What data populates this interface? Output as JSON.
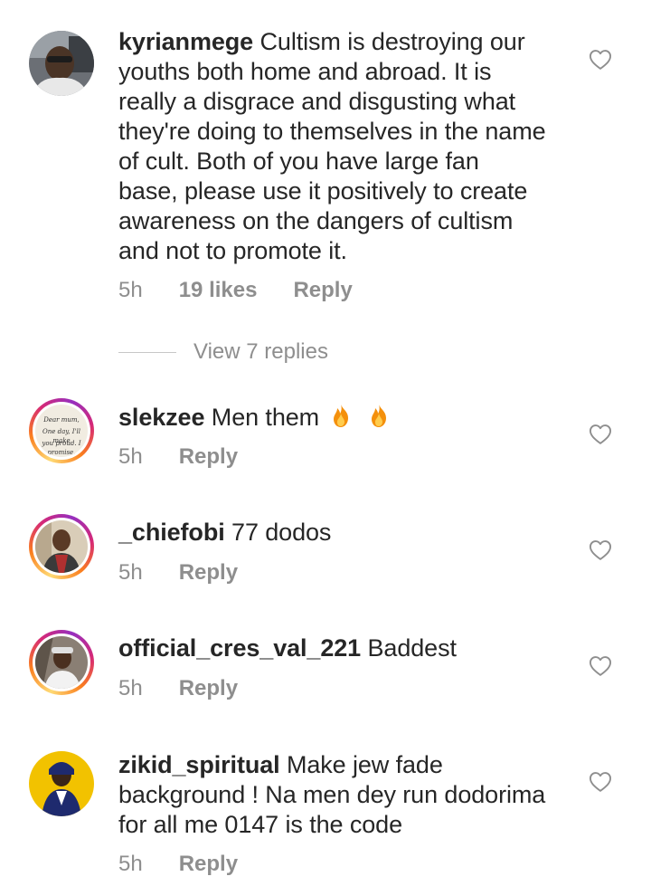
{
  "comments": [
    {
      "username": "kyrianmege",
      "text": "Cultism is destroying our youths both home and abroad. It is really a disgrace and disgusting what they're doing to themselves in the name of cult. Both of you have large fan base, please use it positively to create awareness on the dangers of cultism and not to promote it.",
      "lines": [
        "Cultism is destroying our",
        "youths both home and abroad. It is",
        "really a disgrace and disgusting what",
        "they're doing to themselves in the name",
        "of cult. Both of you have large fan",
        "base, please use it positively to create",
        "awareness on the dangers of cultism",
        "and not to promote it."
      ],
      "time": "5h",
      "likes": "19 likes",
      "reply": "Reply"
    },
    {
      "username": "slekzee",
      "text": "Men them",
      "time": "5h",
      "reply": "Reply",
      "avatar_text": [
        "Dear mum,",
        "One day, I'll make",
        "you proud. I promise."
      ]
    },
    {
      "username": "_chiefobi",
      "text": "77 dodos",
      "time": "5h",
      "reply": "Reply"
    },
    {
      "username": "official_cres_val_221",
      "text": "Baddest",
      "time": "5h",
      "reply": "Reply"
    },
    {
      "username": "zikid_spiritual",
      "text": "Make jew fade background ! Na men dey run dodorima for all me 0147 is the code",
      "lines": [
        "Make jew fade",
        "background ! Na men dey run dodorima",
        "for all me 0147 is the code"
      ],
      "time": "5h",
      "reply": "Reply"
    }
  ],
  "view_replies": "View 7 replies",
  "icons": {
    "heart": "heart-outline-icon",
    "fire": "fire-emoji"
  },
  "colors": {
    "text": "#262626",
    "meta": "#8e8e8e",
    "story_ring_start": "#feda75",
    "story_ring_end": "#d62976"
  }
}
